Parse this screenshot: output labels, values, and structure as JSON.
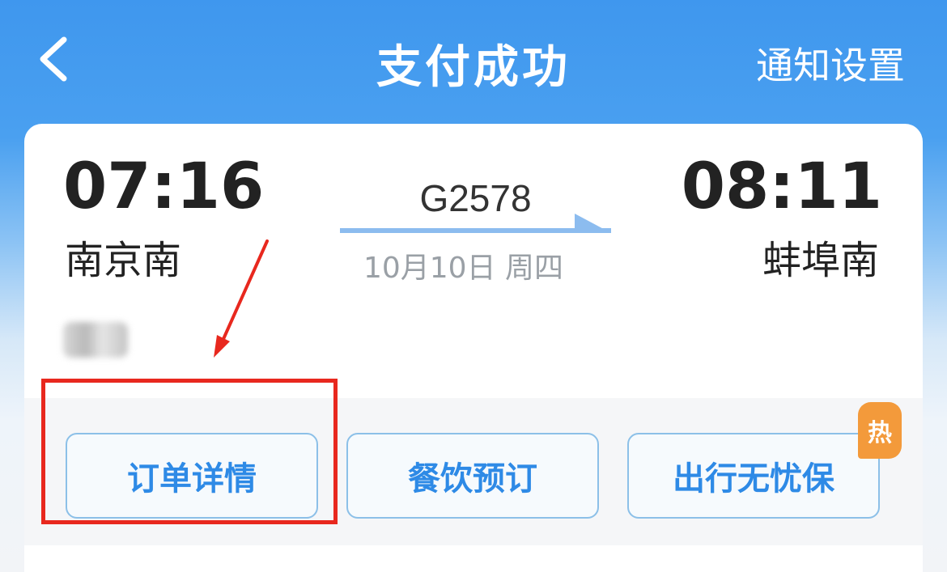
{
  "header": {
    "title": "支付成功",
    "notify_settings": "通知设置",
    "back_icon": "chevron-left-icon"
  },
  "trip": {
    "departure_time": "07:16",
    "departure_station": "南京南",
    "arrival_time": "08:11",
    "arrival_station": "蚌埠南",
    "train_number": "G2578",
    "date": "10月10日 周四"
  },
  "actions": {
    "order_details": "订单详情",
    "dining": "餐饮预订",
    "travel_insurance": "出行无忧保",
    "hot_badge": "热"
  },
  "colors": {
    "brand_blue": "#3f97ee",
    "button_text": "#2e8ae6",
    "hot_badge": "#f39a3b",
    "annotation_red": "#e8281e"
  }
}
